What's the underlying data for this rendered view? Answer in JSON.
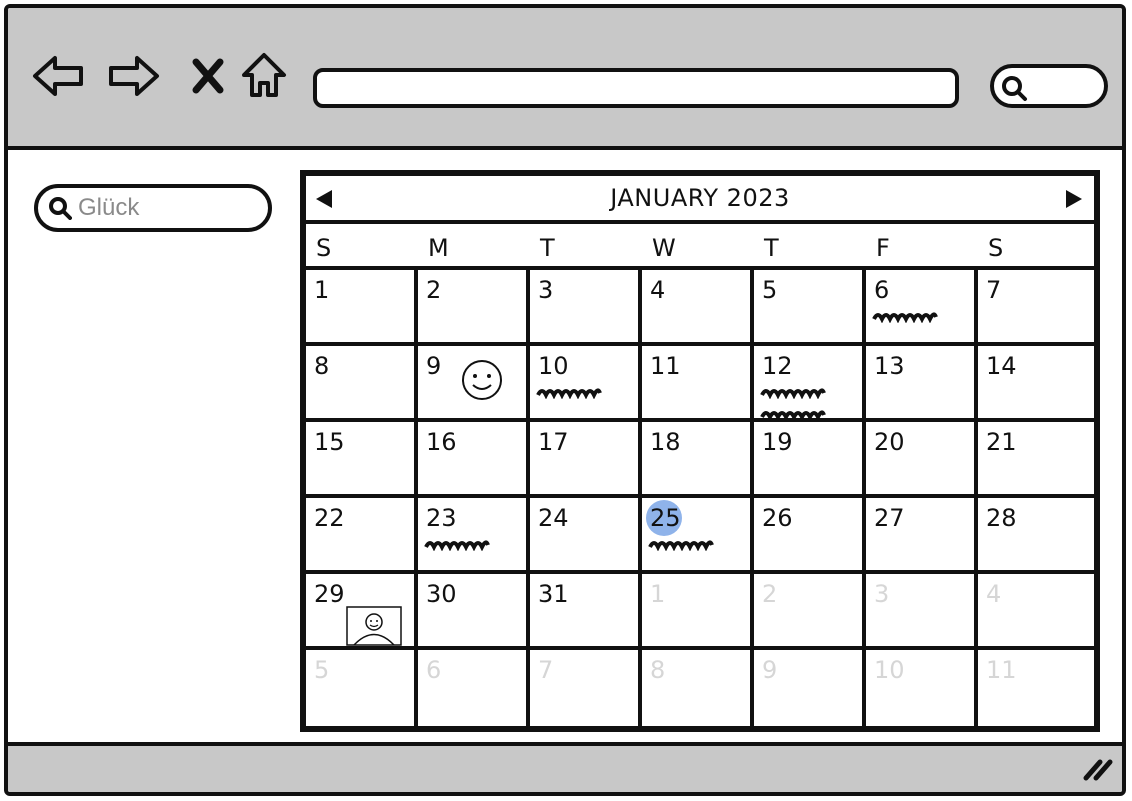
{
  "browser": {
    "nav": [
      {
        "name": "back-button",
        "icon": "arrow-left-icon"
      },
      {
        "name": "forward-button",
        "icon": "arrow-right-icon"
      },
      {
        "name": "stop-button",
        "icon": "close-icon"
      },
      {
        "name": "home-button",
        "icon": "home-icon"
      }
    ],
    "url": "",
    "search_icon": "search-icon"
  },
  "sidebar": {
    "search": {
      "value": "Glück",
      "icon": "search-icon"
    }
  },
  "calendar": {
    "title": "JANUARY 2023",
    "prev_icon": "triangle-left-icon",
    "next_icon": "triangle-right-icon",
    "weekdays": [
      "S",
      "M",
      "T",
      "W",
      "T",
      "F",
      "S"
    ],
    "highlight_color": "#8fb3ea",
    "rows": [
      [
        {
          "d": "1"
        },
        {
          "d": "2"
        },
        {
          "d": "3"
        },
        {
          "d": "4"
        },
        {
          "d": "5"
        },
        {
          "d": "6",
          "scribbles": 1
        },
        {
          "d": "7"
        }
      ],
      [
        {
          "d": "8"
        },
        {
          "d": "9",
          "icon": "smiley-face-icon"
        },
        {
          "d": "10",
          "scribbles": 1
        },
        {
          "d": "11"
        },
        {
          "d": "12",
          "scribbles": 2
        },
        {
          "d": "13"
        },
        {
          "d": "14"
        }
      ],
      [
        {
          "d": "15"
        },
        {
          "d": "16"
        },
        {
          "d": "17"
        },
        {
          "d": "18"
        },
        {
          "d": "19"
        },
        {
          "d": "20"
        },
        {
          "d": "21"
        }
      ],
      [
        {
          "d": "22"
        },
        {
          "d": "23",
          "scribbles": 1
        },
        {
          "d": "24"
        },
        {
          "d": "25",
          "today": true,
          "scribbles": 1
        },
        {
          "d": "26"
        },
        {
          "d": "27"
        },
        {
          "d": "28"
        }
      ],
      [
        {
          "d": "29",
          "icon": "user-image-icon"
        },
        {
          "d": "30"
        },
        {
          "d": "31"
        },
        {
          "d": "1",
          "faded": true
        },
        {
          "d": "2",
          "faded": true
        },
        {
          "d": "3",
          "faded": true
        },
        {
          "d": "4",
          "faded": true
        }
      ],
      [
        {
          "d": "5",
          "faded": true
        },
        {
          "d": "6",
          "faded": true
        },
        {
          "d": "7",
          "faded": true
        },
        {
          "d": "8",
          "faded": true
        },
        {
          "d": "9",
          "faded": true
        },
        {
          "d": "10",
          "faded": true
        },
        {
          "d": "11",
          "faded": true
        }
      ]
    ]
  },
  "statusbar": {
    "resize_icon": "resize-grip-icon"
  }
}
